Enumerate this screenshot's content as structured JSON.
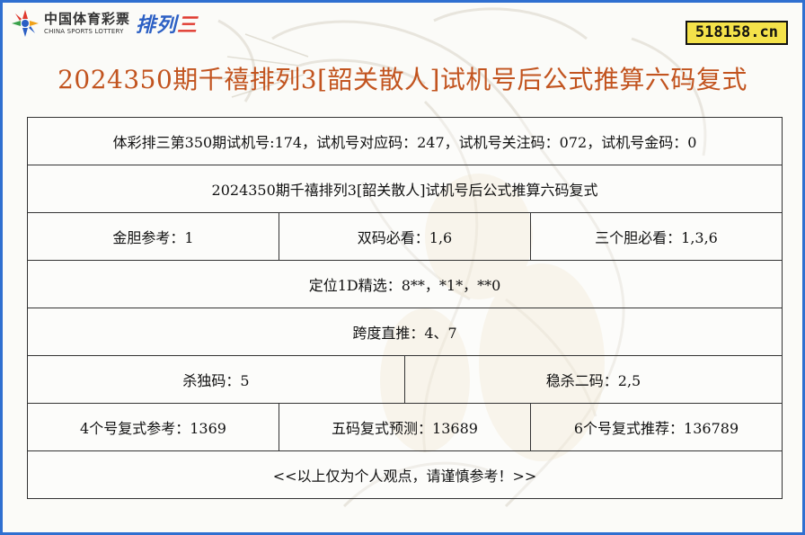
{
  "header": {
    "logo_cn": "中国体育彩票",
    "logo_en": "CHINA SPORTS LOTTERY",
    "logo_game_a": "排列",
    "logo_game_b": "三",
    "site_badge": "518158.cn"
  },
  "page_title": "2024350期千禧排列3[韶关散人]试机号后公式推算六码复式",
  "rows": {
    "trial_info": "体彩排三第350期试机号:174，试机号对应码：247，试机号关注码：072，试机号金码：0",
    "subtitle": "2024350期千禧排列3[韶关散人]试机号后公式推算六码复式",
    "gold_ref": "金胆参考：1",
    "double_must": "双码必看：1,6",
    "three_must": "三个胆必看：1,3,6",
    "position_1d": "定位1D精选：8**，*1*，**0",
    "span": "跨度直推：4、7",
    "kill_single": "杀独码：5",
    "kill_two": "稳杀二码：2,5",
    "four_ref": "4个号复式参考：1369",
    "five_pred": "五码复式预测：13689",
    "six_rec": "6个号复式推荐：136789",
    "disclaimer": "<<以上仅为个人观点，请谨慎参考！>>"
  },
  "colors": {
    "frame_border": "#2f6fd0",
    "title": "#c2541f",
    "badge_bg": "#f4e24a"
  }
}
